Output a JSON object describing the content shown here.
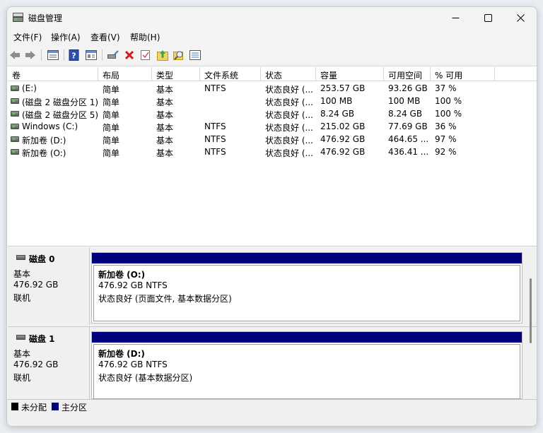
{
  "window": {
    "title": "磁盘管理"
  },
  "menu": [
    "文件(F)",
    "操作(A)",
    "查看(V)",
    "帮助(H)"
  ],
  "toolbar_icons": [
    "back-arrow-icon",
    "forward-arrow-icon",
    "disk-list-icon",
    "help-icon",
    "properties-icon",
    "connect-drive-icon",
    "delete-icon",
    "check-icon",
    "import-icon",
    "search-icon",
    "settings-list-icon"
  ],
  "columns": [
    "卷",
    "布局",
    "类型",
    "文件系统",
    "状态",
    "容量",
    "可用空间",
    "% 可用"
  ],
  "volumes": [
    {
      "name": "(E:)",
      "layout": "简单",
      "type": "基本",
      "fs": "NTFS",
      "status": "状态良好 (...",
      "capacity": "253.57 GB",
      "free": "93.26 GB",
      "pct": "37 %"
    },
    {
      "name": "(磁盘 2 磁盘分区 1)",
      "layout": "简单",
      "type": "基本",
      "fs": "",
      "status": "状态良好 (...",
      "capacity": "100 MB",
      "free": "100 MB",
      "pct": "100 %"
    },
    {
      "name": "(磁盘 2 磁盘分区 5)",
      "layout": "简单",
      "type": "基本",
      "fs": "",
      "status": "状态良好 (...",
      "capacity": "8.24 GB",
      "free": "8.24 GB",
      "pct": "100 %"
    },
    {
      "name": "Windows (C:)",
      "layout": "简单",
      "type": "基本",
      "fs": "NTFS",
      "status": "状态良好 (...",
      "capacity": "215.02 GB",
      "free": "77.69 GB",
      "pct": "36 %"
    },
    {
      "name": "新加卷 (D:)",
      "layout": "简单",
      "type": "基本",
      "fs": "NTFS",
      "status": "状态良好 (...",
      "capacity": "476.92 GB",
      "free": "464.65 ...",
      "pct": "97 %"
    },
    {
      "name": "新加卷 (O:)",
      "layout": "简单",
      "type": "基本",
      "fs": "NTFS",
      "status": "状态良好 (...",
      "capacity": "476.92 GB",
      "free": "436.41 ...",
      "pct": "92 %"
    }
  ],
  "disks": [
    {
      "name": "磁盘 0",
      "kind": "基本",
      "size": "476.92 GB",
      "state": "联机",
      "part_title": "新加卷  (O:)",
      "part_size": "476.92 GB NTFS",
      "part_status": "状态良好 (页面文件, 基本数据分区)"
    },
    {
      "name": "磁盘 1",
      "kind": "基本",
      "size": "476.92 GB",
      "state": "联机",
      "part_title": "新加卷  (D:)",
      "part_size": "476.92 GB NTFS",
      "part_status": "状态良好 (基本数据分区)"
    }
  ],
  "legend": [
    {
      "label": "未分配",
      "color": "#000000"
    },
    {
      "label": "主分区",
      "color": "#00007d"
    }
  ]
}
